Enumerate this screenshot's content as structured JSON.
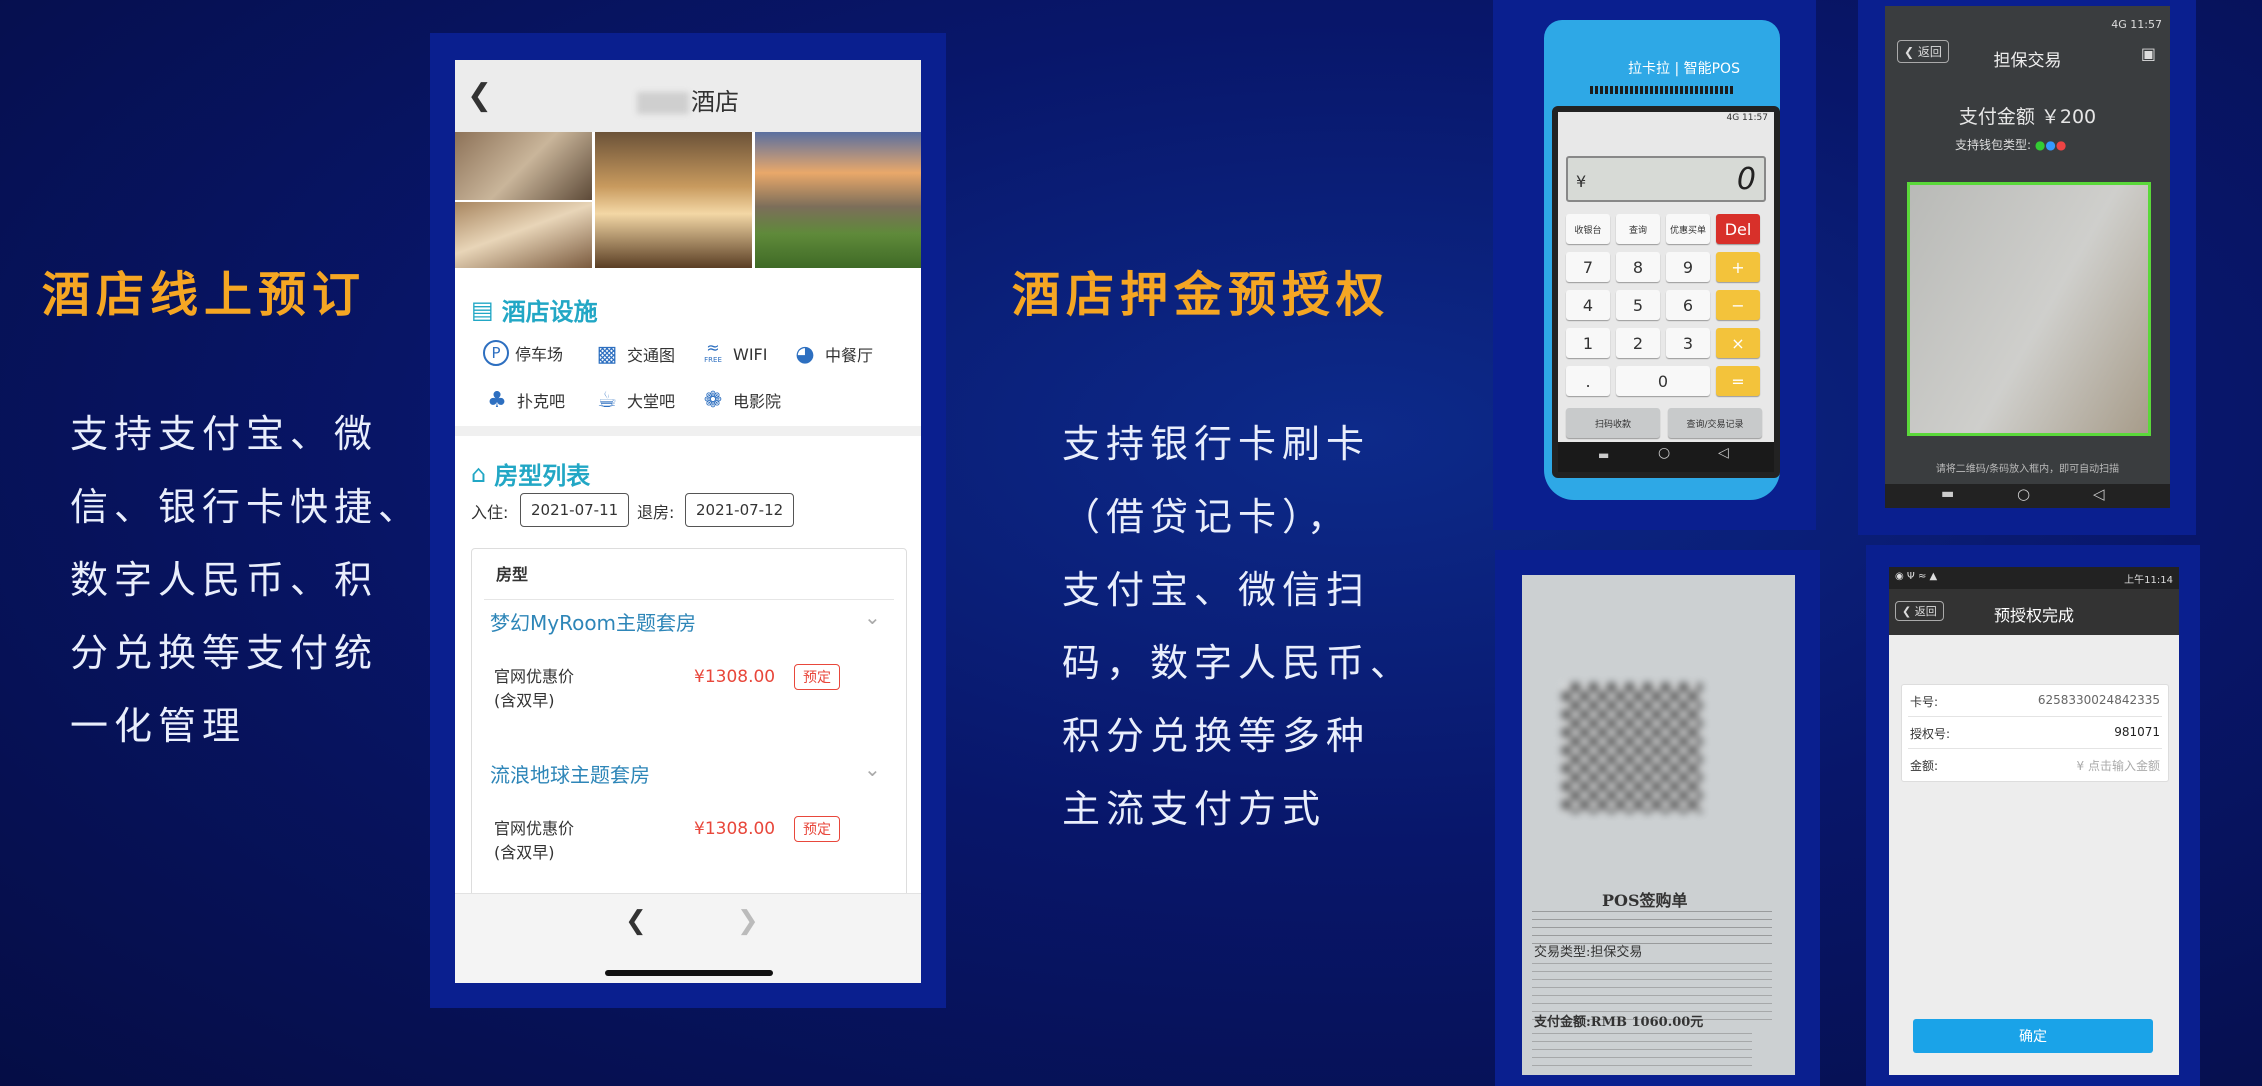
{
  "left": {
    "title": "酒店线上预订",
    "lines": [
      "支持支付宝、微",
      "信、银行卡快捷、",
      "数字人民币、积",
      "分兑换等支付统",
      "一化管理"
    ]
  },
  "middle": {
    "title": "酒店押金预授权",
    "lines": [
      "支持银行卡刷卡",
      "（借贷记卡），",
      "支付宝、微信扫",
      "码，数字人民币、",
      "积分兑换等多种",
      "主流支付方式"
    ]
  },
  "hotel_app": {
    "title_suffix": "酒店",
    "facilities_title": "酒店设施",
    "facilities": [
      {
        "icon": "parking-icon",
        "label": "停车场"
      },
      {
        "icon": "map-icon",
        "label": "交通图"
      },
      {
        "icon": "wifi-icon",
        "label": "WIFI"
      },
      {
        "icon": "restaurant-icon",
        "label": "中餐厅"
      },
      {
        "icon": "poker-icon",
        "label": "扑克吧"
      },
      {
        "icon": "coffee-icon",
        "label": "大堂吧"
      },
      {
        "icon": "cinema-icon",
        "label": "电影院"
      }
    ],
    "wifi_sub": "FREE",
    "rooms_title": "房型列表",
    "checkin_label": "入住:",
    "checkin_date": "2021-07-11",
    "checkout_label": "退房:",
    "checkout_date": "2021-07-12",
    "room_header": "房型",
    "rooms": [
      {
        "name": "梦幻MyRoom主题套房",
        "rate": "官网优惠价",
        "rate_note": "(含双早)",
        "price": "¥1308.00",
        "book": "预定"
      },
      {
        "name": "流浪地球主题套房",
        "rate": "官网优惠价",
        "rate_note": "(含双早)",
        "price": "¥1308.00",
        "book": "预定"
      }
    ]
  },
  "pos": {
    "brand": "拉卡拉 | 智能POS",
    "status": "4G 11:57",
    "currency": "¥",
    "amount": "0",
    "func_keys": [
      "收银台",
      "查询",
      "优惠买单"
    ],
    "del": "Del",
    "keys": [
      "7",
      "8",
      "9",
      "4",
      "5",
      "6",
      "1",
      "2",
      "3",
      ".",
      "0"
    ],
    "op_keys": [
      "+",
      "−",
      "×",
      "="
    ],
    "bottom_keys": [
      "扫码收款",
      "查询/交易记录"
    ]
  },
  "scan": {
    "status": "4G 11:57",
    "back": "返回",
    "title": "担保交易",
    "amount_label": "支付金额 ￥200",
    "wallet_label": "支持钱包类型:",
    "hint": "请将二维码/条码放入框内，即可自动扫描"
  },
  "receipt": {
    "title": "POS签购单",
    "type_line": "交易类型:担保交易",
    "amount_line": "支付金额:RMB 1060.00元"
  },
  "preauth": {
    "status_time": "上午11:14",
    "back": "返回",
    "title": "预授权完成",
    "card_label": "卡号:",
    "card_value": "6258330024842335",
    "auth_label": "授权号:",
    "auth_value": "981071",
    "amount_label": "金额:",
    "amount_placeholder": "¥ 点击输入金额",
    "confirm": "确定"
  }
}
